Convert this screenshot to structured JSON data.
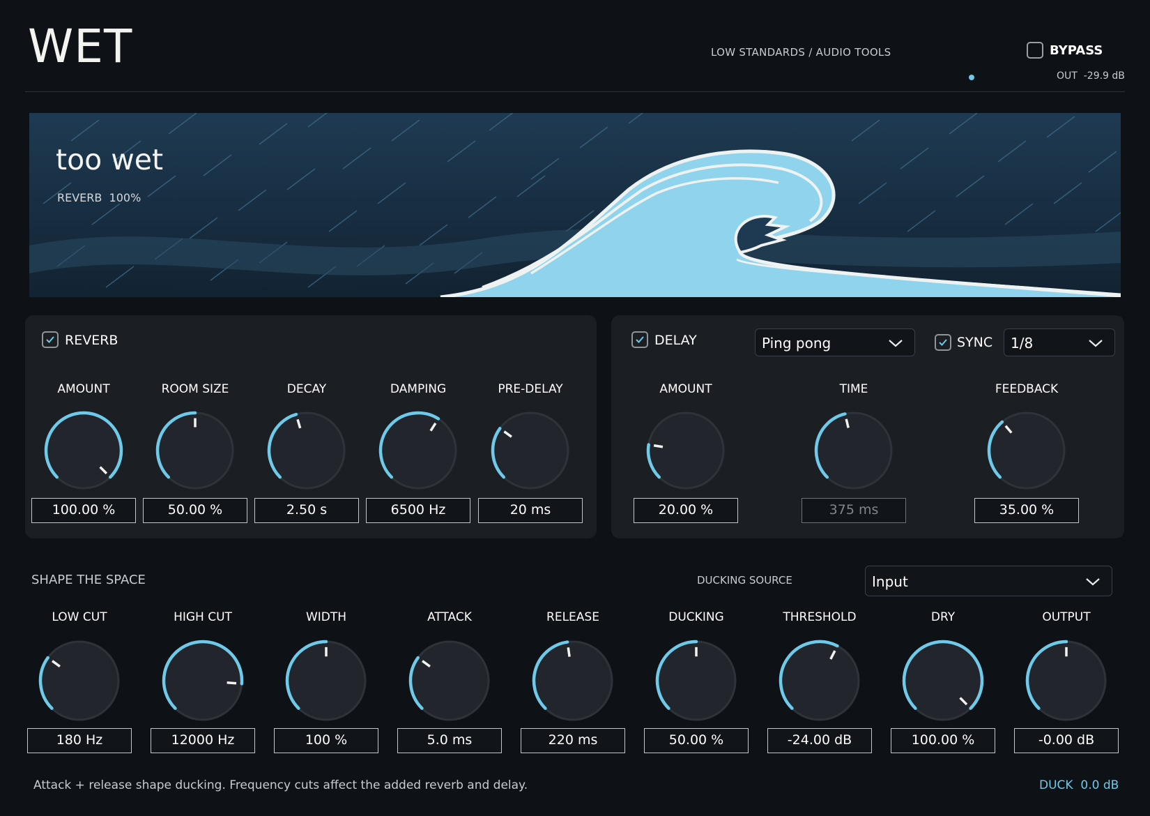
{
  "header": {
    "app_title": "WET",
    "brand": "LOW STANDARDS / AUDIO TOOLS",
    "bypass_label": "BYPASS",
    "bypass_checked": false,
    "out_label": "OUT",
    "out_value": "-29.9 dB"
  },
  "banner": {
    "title": "too wet",
    "subtitle_label": "REVERB",
    "subtitle_value": "100%"
  },
  "reverb": {
    "label": "REVERB",
    "enabled": true,
    "knobs": [
      {
        "label": "AMOUNT",
        "value": "100.00 %",
        "level": 1.0
      },
      {
        "label": "ROOM SIZE",
        "value": "50.00 %",
        "level": 0.5
      },
      {
        "label": "DECAY",
        "value": "2.50 s",
        "level": 0.44
      },
      {
        "label": "DAMPING",
        "value": "6500 Hz",
        "level": 0.62
      },
      {
        "label": "PRE-DELAY",
        "value": "20 ms",
        "level": 0.3
      }
    ]
  },
  "delay": {
    "label": "DELAY",
    "enabled": true,
    "mode": "Ping pong",
    "sync_label": "SYNC",
    "sync_enabled": true,
    "division": "1/8",
    "knobs": [
      {
        "label": "AMOUNT",
        "value": "20.00 %",
        "level": 0.2,
        "dim": false
      },
      {
        "label": "TIME",
        "value": "375 ms",
        "level": 0.45,
        "dim": true
      },
      {
        "label": "FEEDBACK",
        "value": "35.00 %",
        "level": 0.35,
        "dim": false
      }
    ]
  },
  "shape": {
    "section_label": "SHAPE THE SPACE",
    "ducking_source_label": "DUCKING SOURCE",
    "ducking_source": "Input",
    "knobs": [
      {
        "label": "LOW CUT",
        "value": "180 Hz",
        "level": 0.3
      },
      {
        "label": "HIGH CUT",
        "value": "12000 Hz",
        "level": 0.85
      },
      {
        "label": "WIDTH",
        "value": "100 %",
        "level": 0.5
      },
      {
        "label": "ATTACK",
        "value": "5.0 ms",
        "level": 0.3
      },
      {
        "label": "RELEASE",
        "value": "220 ms",
        "level": 0.47
      },
      {
        "label": "DUCKING",
        "value": "50.00 %",
        "level": 0.5
      },
      {
        "label": "THRESHOLD",
        "value": "-24.00 dB",
        "level": 0.6
      },
      {
        "label": "DRY",
        "value": "100.00 %",
        "level": 1.0
      },
      {
        "label": "OUTPUT",
        "value": "-0.00 dB",
        "level": 0.5
      }
    ]
  },
  "footer": {
    "note": "Attack + release shape ducking. Frequency cuts affect the added reverb and delay.",
    "duck_label": "DUCK",
    "duck_value": "0.0 dB"
  },
  "colors": {
    "accent": "#6fc9e8",
    "background": "#0e1115",
    "panel": "#1b1f24",
    "knob_body": "#22262c"
  }
}
